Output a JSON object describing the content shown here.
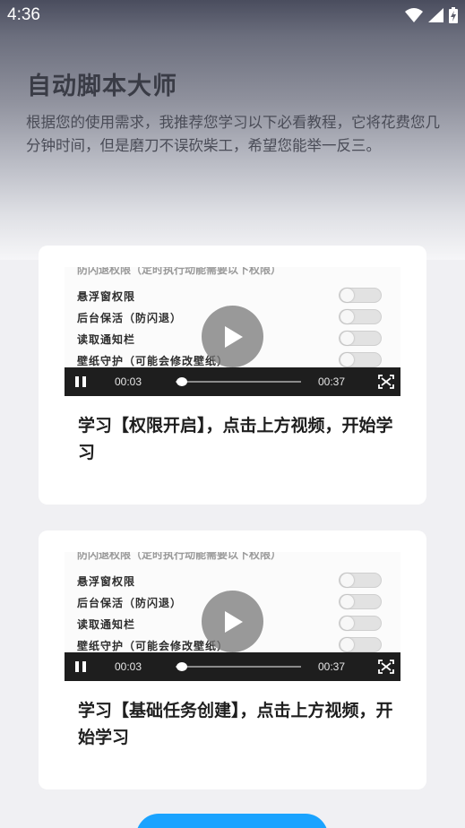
{
  "status_bar": {
    "time": "4:36",
    "icons": [
      "wifi-icon",
      "cell-signal-icon",
      "battery-charging-icon"
    ]
  },
  "header": {
    "title": "自动脚本大师",
    "description": "根据您的使用需求，我推荐您学习以下必看教程，它将花费您几分钟时间，但是磨刀不误砍柴工，希望您能举一反三。"
  },
  "video_preview": {
    "cut_off_text": "防闪退权限（定时执行动能需要以下权限）",
    "permissions": [
      "悬浮窗权限",
      "后台保活（防闪退）",
      "读取通知栏",
      "壁纸守护（可能会修改壁纸）"
    ],
    "current_time": "00:03",
    "duration": "00:37",
    "progress": 0.08
  },
  "cards": [
    {
      "caption": "学习【权限开启】，点击上方视频，开始学习"
    },
    {
      "caption": "学习【基础任务创建】，点击上方视频，开始学习"
    }
  ],
  "colors": {
    "accent": "#1aa3ff",
    "card_bg": "#ffffff",
    "page_bg": "#f0f0f3",
    "title": "#3a3c46"
  }
}
